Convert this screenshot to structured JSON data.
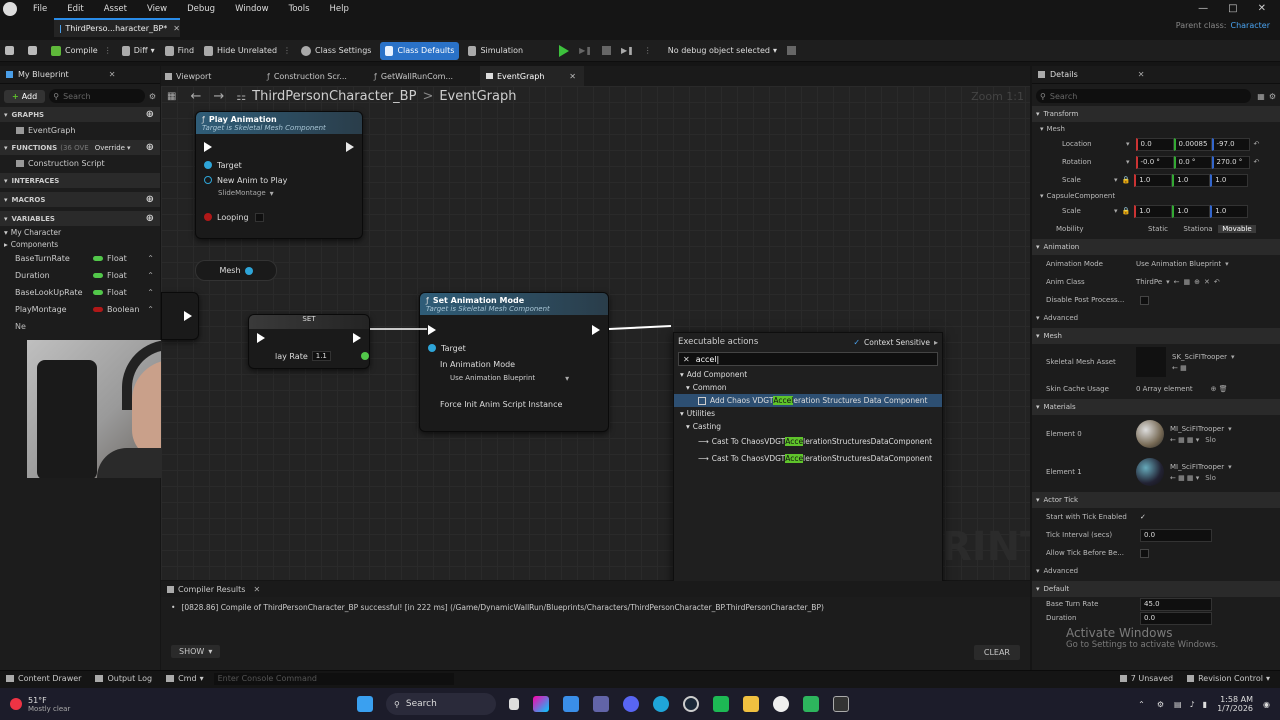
{
  "menu": {
    "items": [
      "File",
      "Edit",
      "Asset",
      "View",
      "Debug",
      "Window",
      "Tools",
      "Help"
    ],
    "parent_class_label": "Parent class:",
    "parent_class_value": "Character"
  },
  "doc_tab": {
    "label": "ThirdPerso...haracter_BP*"
  },
  "toolbar": {
    "compile": "Compile",
    "diff": "Diff",
    "find": "Find",
    "hide_unrelated": "Hide Unrelated",
    "class_settings": "Class Settings",
    "class_defaults": "Class Defaults",
    "simulation": "Simulation",
    "debug_object": "No debug object selected"
  },
  "my_blueprint": {
    "title": "My Blueprint",
    "add": "Add",
    "search_placeholder": "Search",
    "graphs_header": "GRAPHS",
    "event_graph": "EventGraph",
    "functions_header": "FUNCTIONS",
    "functions_count": "(36 OVE",
    "override": "Override",
    "construction_script": "Construction Script",
    "interfaces_header": "INTERFACES",
    "macros_header": "MACROS",
    "variables_header": "VARIABLES",
    "my_character": "My Character",
    "components": "Components",
    "variables": [
      {
        "name": "BaseTurnRate",
        "type": "Float",
        "color": "#52c74a"
      },
      {
        "name": "Duration",
        "type": "Float",
        "color": "#52c74a"
      },
      {
        "name": "BaseLookUpRate",
        "type": "Float",
        "color": "#52c74a"
      },
      {
        "name": "PlayMontage",
        "type": "Boolean",
        "color": "#b01818"
      }
    ]
  },
  "tabs": {
    "viewport": "Viewport",
    "construction": "Construction Scr...",
    "getwallrun": "GetWallRunCom...",
    "eventgraph": "EventGraph"
  },
  "breadcrumb": {
    "bp": "ThirdPersonCharacter_BP",
    "graph": "EventGraph",
    "zoom": "Zoom 1:1"
  },
  "nodes": {
    "play_anim": {
      "title": "Play Animation",
      "subtitle": "Target is Skeletal Mesh Component",
      "target": "Target",
      "new_anim": "New Anim to Play",
      "montage": "SlideMontage",
      "looping": "Looping"
    },
    "mesh": "Mesh",
    "set": {
      "title": "SET",
      "play_rate_label": "lay Rate",
      "play_rate_value": "1.1"
    },
    "set_anim_mode": {
      "title": "Set Animation Mode",
      "subtitle": "Target is Skeletal Mesh Component",
      "target": "Target",
      "in_mode": "In Animation Mode",
      "mode_value": "Use Animation Blueprint",
      "force_init": "Force Init Anim Script Instance"
    }
  },
  "popup": {
    "title": "Executable actions",
    "context_sensitive": "Context Sensitive",
    "query": "accel",
    "cat_add_component": "Add Component",
    "cat_common": "Common",
    "item1_pre": "Add Chaos VDGT",
    "item1_hl": "Accel",
    "item1_post": "eration Structures Data Component",
    "cat_utilities": "Utilities",
    "cat_casting": "Casting",
    "cast_pre": "Cast To ChaosVDGT",
    "cast_hl": "Acce",
    "cast_post": "lerationStructuresDataComponent",
    "cast2_pre": "Cast To ChaosVDGT",
    "cast2_hl": "Acce",
    "cast2_post": "lerationStructuresDataComponent"
  },
  "watermark": "RINT",
  "compiler": {
    "tab": "Compiler Results",
    "message": "[0828.86] Compile of ThirdPersonCharacter_BP successful! [in 222 ms] (/Game/DynamicWallRun/Blueprints/Characters/ThirdPersonCharacter_BP.ThirdPersonCharacter_BP)",
    "show": "SHOW",
    "clear": "CLEAR"
  },
  "details": {
    "title": "Details",
    "search_placeholder": "Search",
    "transform": "Transform",
    "mesh_sub": "Mesh",
    "location": "Location",
    "loc": [
      "0.0",
      "0.00085",
      "-97.0"
    ],
    "rotation": "Rotation",
    "rot": [
      "-0.0 °",
      "0.0 °",
      "270.0 °"
    ],
    "scale": "Scale",
    "scl": [
      "1.0",
      "1.0",
      "1.0"
    ],
    "capsule": "CapsuleComponent",
    "cap_scale": [
      "1.0",
      "1.0",
      "1.0"
    ],
    "mobility": "Mobility",
    "mob_static": "Static",
    "mob_stationary": "Stationa",
    "mob_movable": "Movable",
    "animation": "Animation",
    "anim_mode": "Animation Mode",
    "anim_mode_val": "Use Animation Blueprint",
    "anim_class": "Anim Class",
    "anim_class_val": "ThirdPe",
    "disable_post": "Disable Post Process...",
    "advanced": "Advanced",
    "mesh": "Mesh",
    "skel_asset": "Skeletal Mesh Asset",
    "skel_val": "SK_SciFITrooper",
    "skin_cache": "Skin Cache Usage",
    "skin_cache_val": "0 Array element",
    "materials": "Materials",
    "el0": "Element 0",
    "el0_val": "MI_SciFITrooper",
    "el1": "Element 1",
    "el1_val": "MI_SciFITrooper",
    "slo": "Slo",
    "actor_tick": "Actor Tick",
    "start_tick": "Start with Tick Enabled",
    "tick_interval": "Tick Interval (secs)",
    "tick_val": "0.0",
    "allow_tick": "Allow Tick Before Be...",
    "advanced2": "Advanced",
    "default": "Default",
    "base_turn": "Base Turn Rate",
    "base_turn_val": "45.0",
    "duration": "Duration",
    "duration_val": "0.0"
  },
  "activate": {
    "line1": "Activate Windows",
    "line2": "Go to Settings to activate Windows."
  },
  "status": {
    "content_drawer": "Content Drawer",
    "output_log": "Output Log",
    "cmd": "Cmd",
    "console_placeholder": "Enter Console Command",
    "unsaved": "7 Unsaved",
    "revision": "Revision Control"
  },
  "taskbar": {
    "weather_temp": "51°F",
    "weather_desc": "Mostly clear",
    "search": "Search",
    "time": "1:58 AM",
    "date": "1/7/2026"
  }
}
